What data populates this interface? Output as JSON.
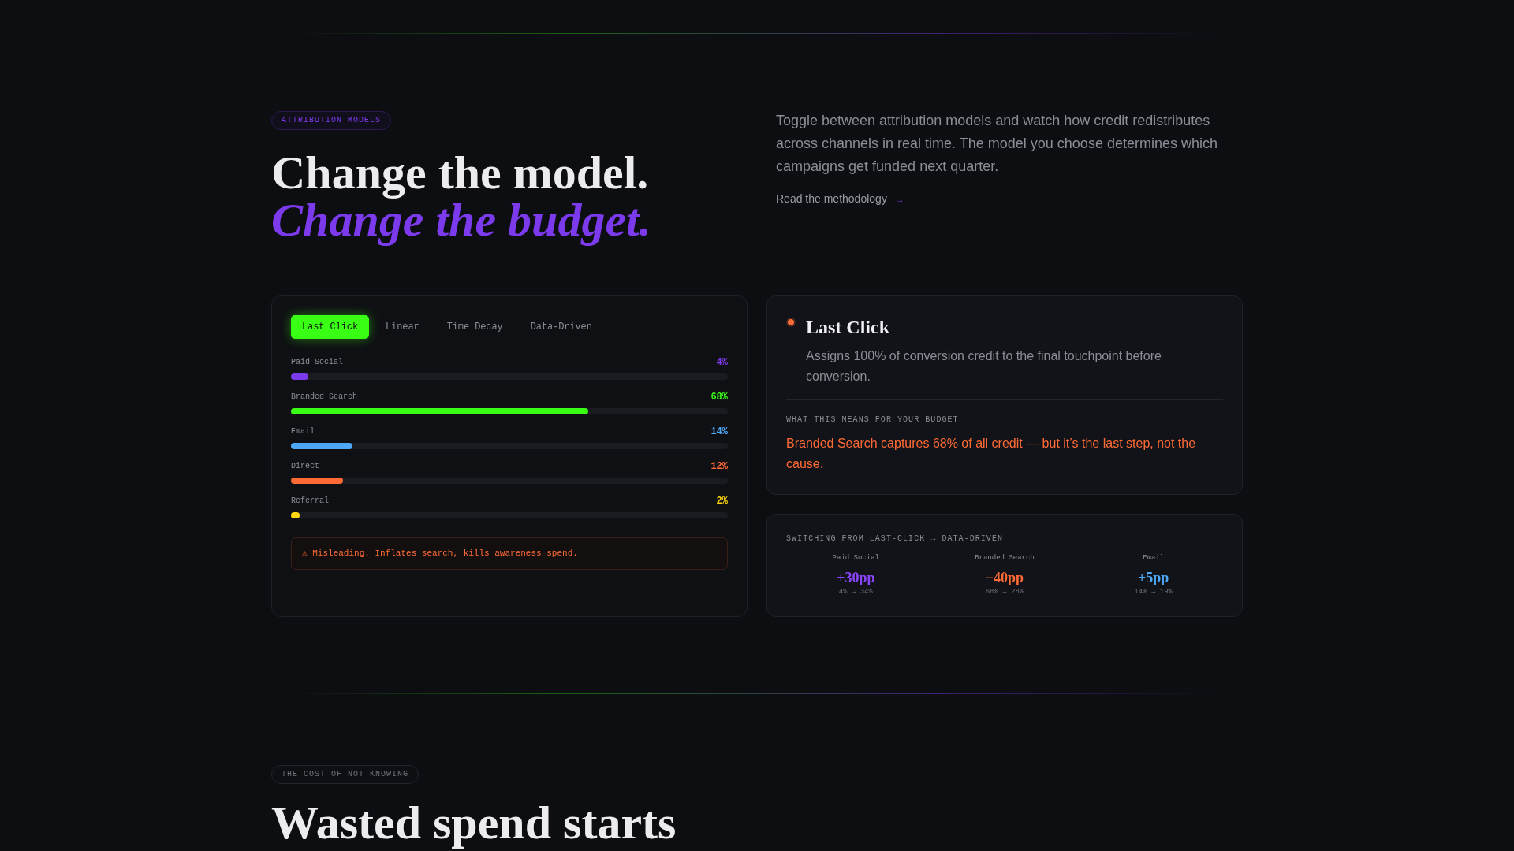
{
  "header": {
    "badge": "ATTRIBUTION MODELS",
    "heading_line_1": "Change the model.",
    "heading_line_2": "Change the budget.",
    "intro": "Toggle between attribution models and watch how credit redistributes across channels in real time. The model you choose determines which campaigns get funded next quarter.",
    "link": {
      "label": "Read the methodology",
      "arrow": "→"
    }
  },
  "model_panel": {
    "tabs": [
      {
        "label": "Last Click",
        "selected": true
      },
      {
        "label": "Linear",
        "selected": false
      },
      {
        "label": "Time Decay",
        "selected": false
      },
      {
        "label": "Data-Driven",
        "selected": false
      }
    ],
    "channels": [
      {
        "name": "Paid Social",
        "reading": "4%",
        "level": 0.04,
        "color": "#7c3aed"
      },
      {
        "name": "Branded Search",
        "reading": "68%",
        "level": 0.68,
        "color": "#39ff14"
      },
      {
        "name": "Email",
        "reading": "14%",
        "level": 0.14,
        "color": "#4ea8f8"
      },
      {
        "name": "Direct",
        "reading": "12%",
        "level": 0.12,
        "color": "#ff6b35"
      },
      {
        "name": "Referral",
        "reading": "2%",
        "level": 0.02,
        "color": "#ffd60a"
      }
    ],
    "warning": "⚠ Misleading. Inflates search, kills awareness spend."
  },
  "model_card": {
    "title": "Last Click",
    "description": "Assigns 100% of conversion credit to the final touchpoint before conversion.",
    "budget_label": "WHAT THIS MEANS FOR YOUR BUDGET",
    "budget_note": "Branded Search captures 68% of all credit — but it’s the last step, not the cause."
  },
  "switch_card": {
    "title": "SWITCHING FROM LAST-CLICK → DATA-DRIVEN",
    "changes": [
      {
        "channel": "Paid Social",
        "delta": "+30pp",
        "range": "4% → 34%",
        "color": "#8b45ff"
      },
      {
        "channel": "Branded Search",
        "delta": "−40pp",
        "range": "68% → 28%",
        "color": "#ff6b35"
      },
      {
        "channel": "Email",
        "delta": "+5pp",
        "range": "14% → 19%",
        "color": "#4ea8f8"
      }
    ]
  },
  "next_section": {
    "badge": "THE COST OF NOT KNOWING",
    "heading": "Wasted spend starts"
  }
}
